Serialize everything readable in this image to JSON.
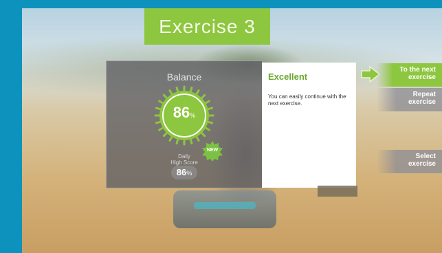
{
  "header": {
    "title": "Exercise 3"
  },
  "result": {
    "metric_label": "Balance",
    "score": "86",
    "score_unit": "%",
    "high_score_label_line1": "Daily",
    "high_score_label_line2": "High Score",
    "new_badge": "NEW",
    "high_score": "86",
    "high_score_unit": "%"
  },
  "message": {
    "title": "Excellent",
    "body": "You can easily continue with the next exercise."
  },
  "actions": {
    "next_line1": "To the next",
    "next_line2": "exercise",
    "repeat_line1": "Repeat",
    "repeat_line2": "exercise",
    "select_line1": "Select",
    "select_line2": "exercise"
  },
  "colors": {
    "accent_green": "#8dc63f",
    "frame_blue": "#0d92bd"
  }
}
